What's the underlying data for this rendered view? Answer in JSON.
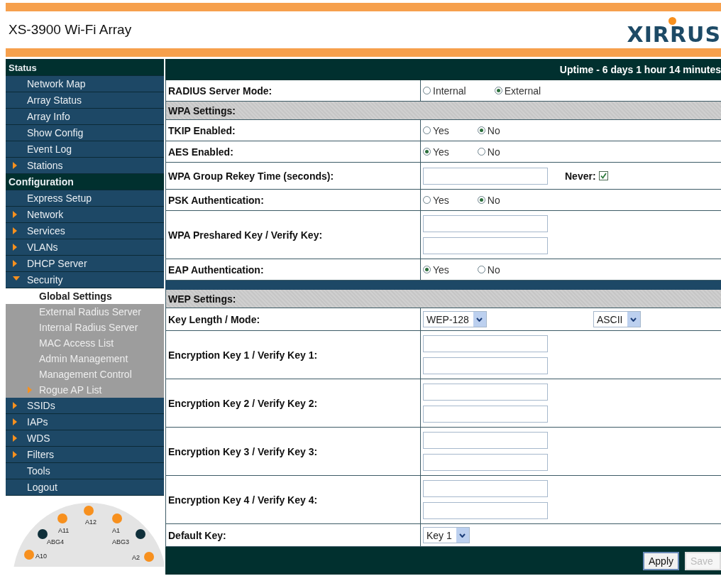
{
  "header": {
    "title": "XS-3900 Wi-Fi Array",
    "logo": "XIRRUS"
  },
  "sidebar": {
    "sections": [
      {
        "label": "Status",
        "items": [
          {
            "label": "Network Map",
            "selected": false
          },
          {
            "label": "Array Status",
            "selected": false
          },
          {
            "label": "Array Info",
            "selected": false
          },
          {
            "label": "Show Config",
            "selected": false
          },
          {
            "label": "Event Log",
            "selected": false
          },
          {
            "label": "Stations",
            "selected": false,
            "expanded": false
          }
        ]
      },
      {
        "label": "Configuration",
        "items": [
          {
            "label": "Express Setup",
            "selected": false
          },
          {
            "label": "Network",
            "selected": false,
            "expanded": false
          },
          {
            "label": "Services",
            "selected": false,
            "expanded": false
          },
          {
            "label": "VLANs",
            "selected": false,
            "expanded": false
          },
          {
            "label": "DHCP Server",
            "selected": false,
            "expanded": false
          },
          {
            "label": "Security",
            "selected": false,
            "expanded": true,
            "children": [
              {
                "label": "Global Settings",
                "selected": true
              },
              {
                "label": "External Radius Server",
                "selected": false
              },
              {
                "label": "Internal Radius Server",
                "selected": false
              },
              {
                "label": "MAC Access List",
                "selected": false
              },
              {
                "label": "Admin Management",
                "selected": false
              },
              {
                "label": "Management Control",
                "selected": false
              },
              {
                "label": "Rogue AP List",
                "selected": false,
                "expanded": false
              }
            ]
          },
          {
            "label": "SSIDs",
            "selected": false,
            "expanded": false
          },
          {
            "label": "IAPs",
            "selected": false,
            "expanded": false
          },
          {
            "label": "WDS",
            "selected": false,
            "expanded": false
          },
          {
            "label": "Filters",
            "selected": false,
            "expanded": false
          },
          {
            "label": "Tools",
            "selected": false
          },
          {
            "label": "Logout",
            "selected": false
          }
        ]
      }
    ]
  },
  "array_diagram": {
    "ports": [
      {
        "label": "A12",
        "color": "#f7901e"
      },
      {
        "label": "A11",
        "color": "#f7901e"
      },
      {
        "label": "A1",
        "color": "#f7901e"
      },
      {
        "label": "ABG4",
        "color": "#0f2f3a"
      },
      {
        "label": "ABG3",
        "color": "#0f2f3a"
      },
      {
        "label": "A10",
        "color": "#f7901e"
      },
      {
        "label": "A2",
        "color": "#f7901e"
      }
    ]
  },
  "status_bar": {
    "uptime": "Uptime - 6 days 1 hour 14 minutes"
  },
  "form": {
    "rows": [
      {
        "kind": "radio",
        "label": "RADIUS Server Mode:",
        "options": [
          {
            "label": "Internal",
            "selected": false
          },
          {
            "label": "External",
            "selected": true
          }
        ]
      },
      {
        "kind": "section",
        "label": "WPA Settings:"
      },
      {
        "kind": "radio",
        "label": "TKIP Enabled:",
        "options": [
          {
            "label": "Yes",
            "selected": false
          },
          {
            "label": "No",
            "selected": true
          }
        ]
      },
      {
        "kind": "radio",
        "label": "AES Enabled:",
        "options": [
          {
            "label": "Yes",
            "selected": true
          },
          {
            "label": "No",
            "selected": false
          }
        ]
      },
      {
        "kind": "field_checkbox",
        "label": "WPA Group Rekey Time (seconds):",
        "checkbox": {
          "label": "Never:",
          "checked": true
        }
      },
      {
        "kind": "radio",
        "label": "PSK Authentication:",
        "options": [
          {
            "label": "Yes",
            "selected": false
          },
          {
            "label": "No",
            "selected": true
          }
        ]
      },
      {
        "kind": "two_fields",
        "label": "WPA Preshared Key / Verify Key:"
      },
      {
        "kind": "radio",
        "label": "EAP Authentication:",
        "options": [
          {
            "label": "Yes",
            "selected": true
          },
          {
            "label": "No",
            "selected": false
          }
        ]
      },
      {
        "kind": "divider"
      },
      {
        "kind": "section",
        "label": "WEP Settings:"
      },
      {
        "kind": "selects",
        "label": "Key Length / Mode:",
        "selects": [
          {
            "value": "WEP-128"
          },
          {
            "value": "ASCII"
          }
        ]
      },
      {
        "kind": "two_fields",
        "label": "Encryption Key 1 / Verify Key 1:"
      },
      {
        "kind": "two_fields",
        "label": "Encryption Key 2 / Verify Key 2:"
      },
      {
        "kind": "two_fields",
        "label": "Encryption Key 3 / Verify Key 3:"
      },
      {
        "kind": "two_fields",
        "label": "Encryption Key 4 / Verify Key 4:"
      },
      {
        "kind": "selects",
        "label": "Default Key:",
        "selects": [
          {
            "value": "Key 1"
          }
        ]
      }
    ],
    "buttons": [
      {
        "label": "Apply",
        "disabled": false
      },
      {
        "label": "Save",
        "disabled": true
      }
    ]
  }
}
